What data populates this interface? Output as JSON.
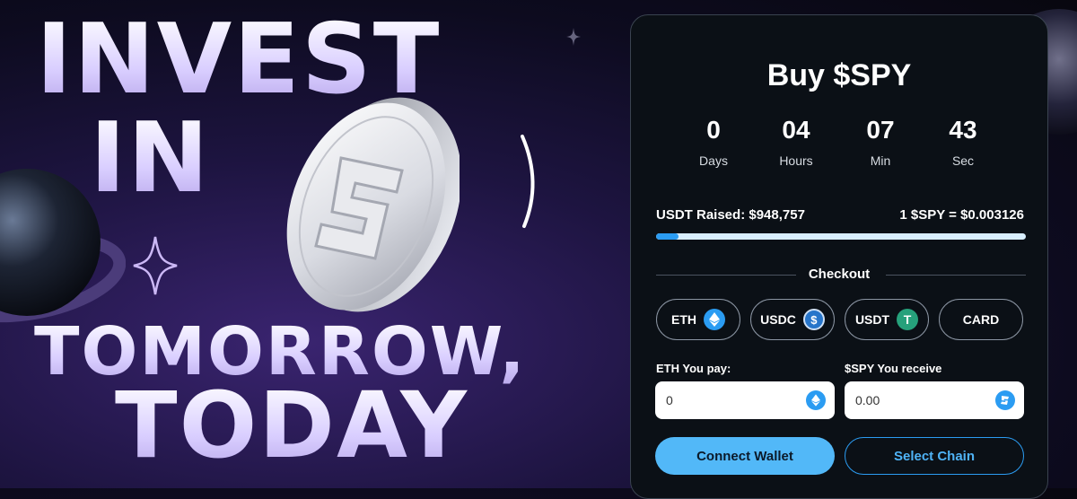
{
  "hero": {
    "line1": "INVEST",
    "line2": "IN",
    "line3": "TOMORROW,",
    "line4": "TODAY"
  },
  "panel": {
    "title": "Buy $SPY",
    "countdown": [
      {
        "value": "0",
        "label": "Days"
      },
      {
        "value": "04",
        "label": "Hours"
      },
      {
        "value": "07",
        "label": "Min"
      },
      {
        "value": "43",
        "label": "Sec"
      }
    ],
    "raised": "USDT Raised: $948,757",
    "rate": "1 $SPY = $0.003126",
    "progress_fraction": 0.06,
    "checkout_label": "Checkout",
    "options": [
      {
        "label": "ETH",
        "icon": "eth-icon",
        "color": "#2b9cf2"
      },
      {
        "label": "USDC",
        "icon": "usdc-icon",
        "color": "#2775ca"
      },
      {
        "label": "USDT",
        "icon": "usdt-icon",
        "color": "#26a17b"
      },
      {
        "label": "CARD",
        "icon": "",
        "color": ""
      }
    ],
    "pay_label": "ETH You pay:",
    "pay_value": "0",
    "receive_label": "$SPY You receive",
    "receive_value": "0.00",
    "connect_wallet": "Connect Wallet",
    "select_chain": "Select Chain"
  },
  "colors": {
    "accent": "#2b9cf2",
    "panel_bg": "#0b1016",
    "hero_text": "#e3dcff"
  }
}
